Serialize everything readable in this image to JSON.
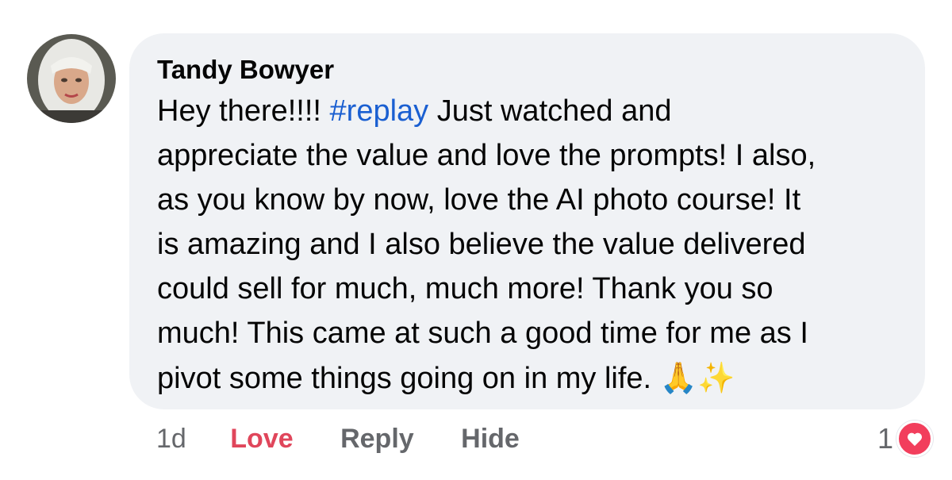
{
  "comment": {
    "author": "Tandy Bowyer",
    "text_lines": [
      {
        "before": "Hey there!!!! ",
        "hashtag": "#replay",
        "after": " Just watched and"
      },
      "appreciate the value and love the prompts! I also,",
      "as you know by now, love the AI photo course! It",
      "is amazing and I also believe the value delivered",
      "could sell for much, much more! Thank you so",
      "much! This came at such a good time for me as I",
      {
        "text": "pivot some things going on in my life. ",
        "emoji": "🙏✨"
      }
    ],
    "avatar_icon": "profile-photo"
  },
  "actions": {
    "timestamp": "1d",
    "love_label": "Love",
    "reply_label": "Reply",
    "hide_label": "Hide"
  },
  "reactions": {
    "count": "1",
    "icon": "heart-icon",
    "color": "#f23e5c"
  },
  "colors": {
    "bubble": "#f0f2f5",
    "hashtag": "#1a5fd1",
    "love": "#e0465b",
    "muted": "#65676b"
  }
}
